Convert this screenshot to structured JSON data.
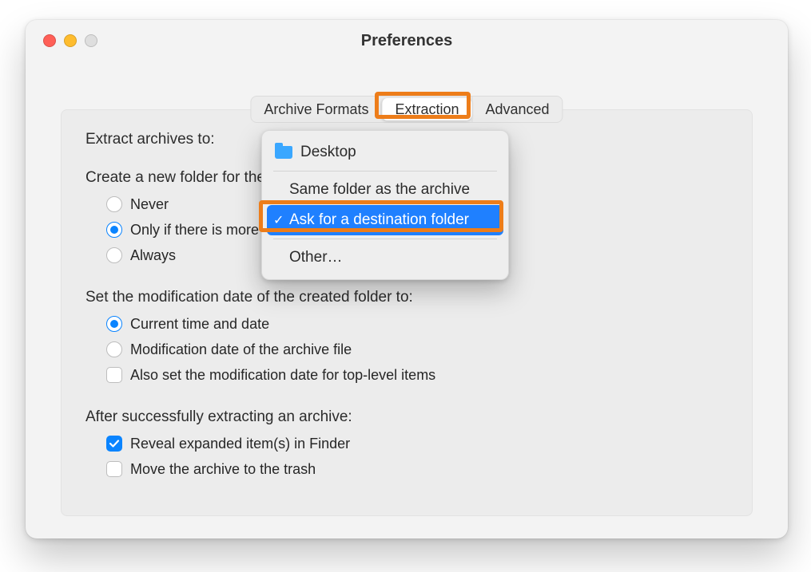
{
  "window": {
    "title": "Preferences"
  },
  "tabs": [
    "Archive Formats",
    "Extraction",
    "Advanced"
  ],
  "labels": {
    "extract_to": "Extract archives to:",
    "create_folder": "Create a new folder for the extracted files:",
    "mod_date": "Set the modification date of the created folder to:",
    "after": "After successfully extracting an archive:"
  },
  "extract_to_menu": [
    "Desktop",
    "Same folder as the archive",
    "Ask for a destination folder",
    "Other…"
  ],
  "create_folder": [
    "Never",
    "Only if there is more than one top-level item",
    "Always"
  ],
  "mod_date": [
    "Current time and date",
    "Modification date of the archive file",
    "Also set the modification date for top-level items"
  ],
  "after": [
    "Reveal expanded item(s) in Finder",
    "Move the archive to the trash"
  ],
  "highlight_color": "#ed7d1a",
  "accent_color": "#0a84ff"
}
